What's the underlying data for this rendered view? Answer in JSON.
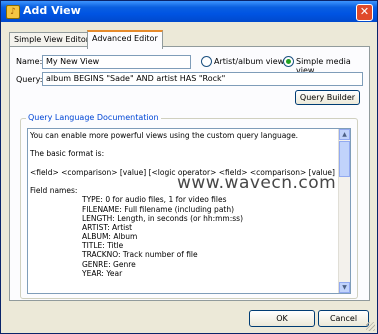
{
  "window": {
    "title": "Add View"
  },
  "tabs": [
    {
      "label": "Simple View Editor"
    },
    {
      "label": "Advanced Editor"
    }
  ],
  "form": {
    "name_label": "Name:",
    "name_value": "My New View",
    "query_label": "Query:",
    "query_value": "album BEGINS \"Sade\" AND artist HAS \"Rock\"",
    "radio_artist_label": "Artist/album view",
    "radio_simple_label": "Simple media view",
    "selected_view": "Simple media view",
    "query_builder_label": "Query Builder"
  },
  "docs": {
    "title": "Query Language Documentation",
    "lines": [
      "You can enable more powerful views using the custom query language.",
      "",
      "The basic format is:",
      "",
      "<field> <comparison> [value] [<logic operator> <field> <comparison> [value] [...]]",
      "",
      "Field names:"
    ],
    "field_lines": [
      "TYPE: 0 for audio files, 1 for video files",
      "FILENAME: Full filename (including path)",
      "LENGTH: Length, in seconds (or hh:mm:ss)",
      "ARTIST: Artist",
      "ALBUM: Album",
      "TITLE: Title",
      "TRACKNO: Track number of file",
      "GENRE: Genre",
      "YEAR: Year"
    ]
  },
  "watermark": "www.wavecn.com",
  "buttons": {
    "ok": "OK",
    "cancel": "Cancel"
  }
}
